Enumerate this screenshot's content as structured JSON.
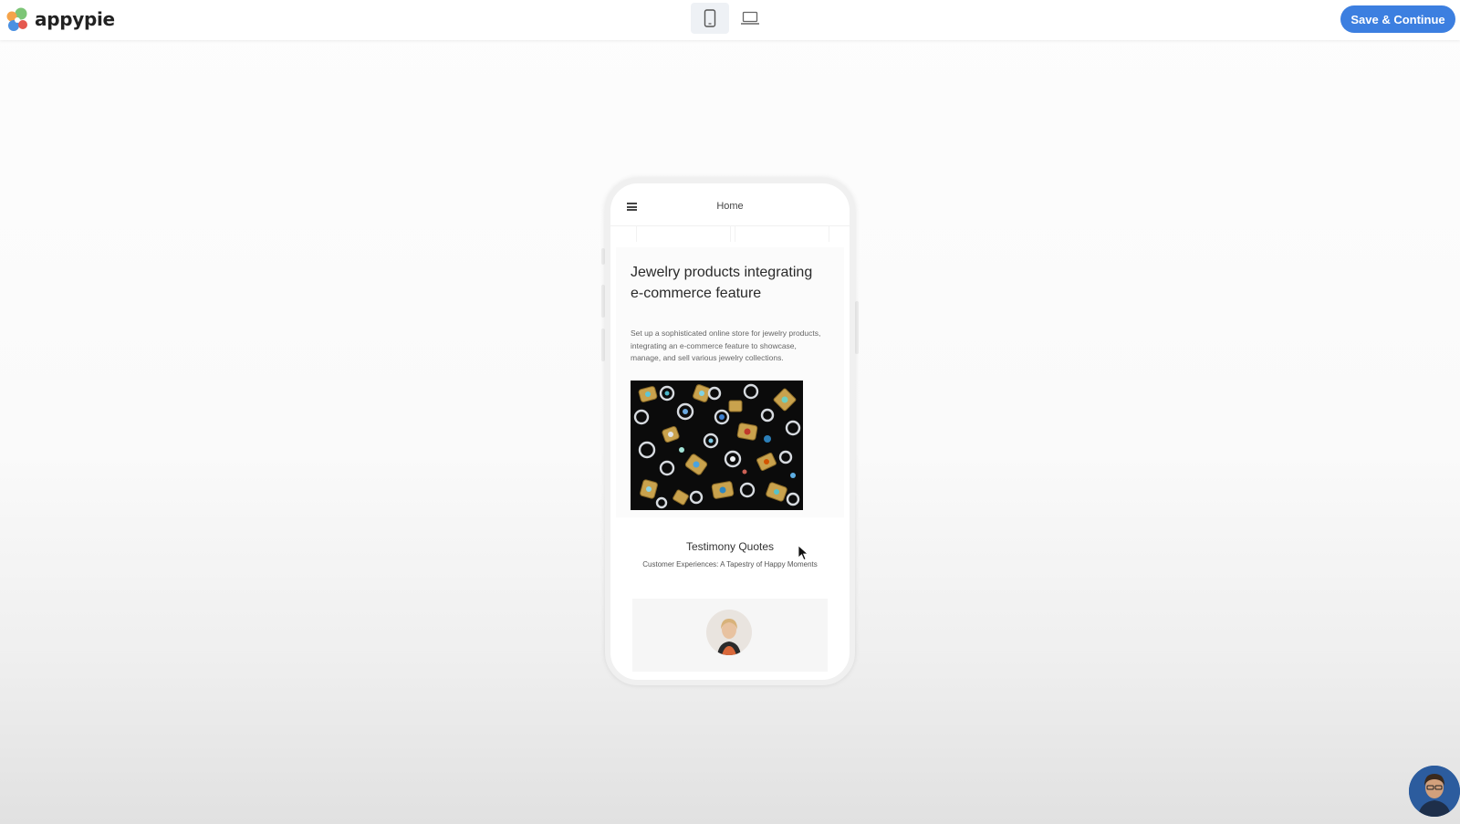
{
  "header": {
    "app_name": "appypie",
    "device_options": [
      {
        "name": "mobile",
        "active": true
      },
      {
        "name": "desktop",
        "active": false
      }
    ],
    "save_label": "Save & Continue"
  },
  "preview": {
    "nav_title": "Home",
    "hero_title": "Jewelry products integrating e-commerce feature",
    "hero_description": "Set up a sophisticated online store for jewelry products, integrating an e-commerce feature to showcase, manage, and sell various jewelry collections.",
    "testimony_title": "Testimony Quotes",
    "testimony_subtitle": "Customer Experiences: A Tapestry of Happy Moments"
  },
  "colors": {
    "accent": "#3c7fe0",
    "logo_green": "#7cc576",
    "logo_orange": "#f5a34a",
    "logo_blue": "#4a90e2",
    "logo_red": "#e5584f"
  },
  "icons": {
    "logo": "appypie-logo-icon",
    "mobile": "mobile-phone-icon",
    "desktop": "laptop-icon",
    "menu": "hamburger-menu-icon",
    "cursor": "mouse-pointer-icon"
  }
}
